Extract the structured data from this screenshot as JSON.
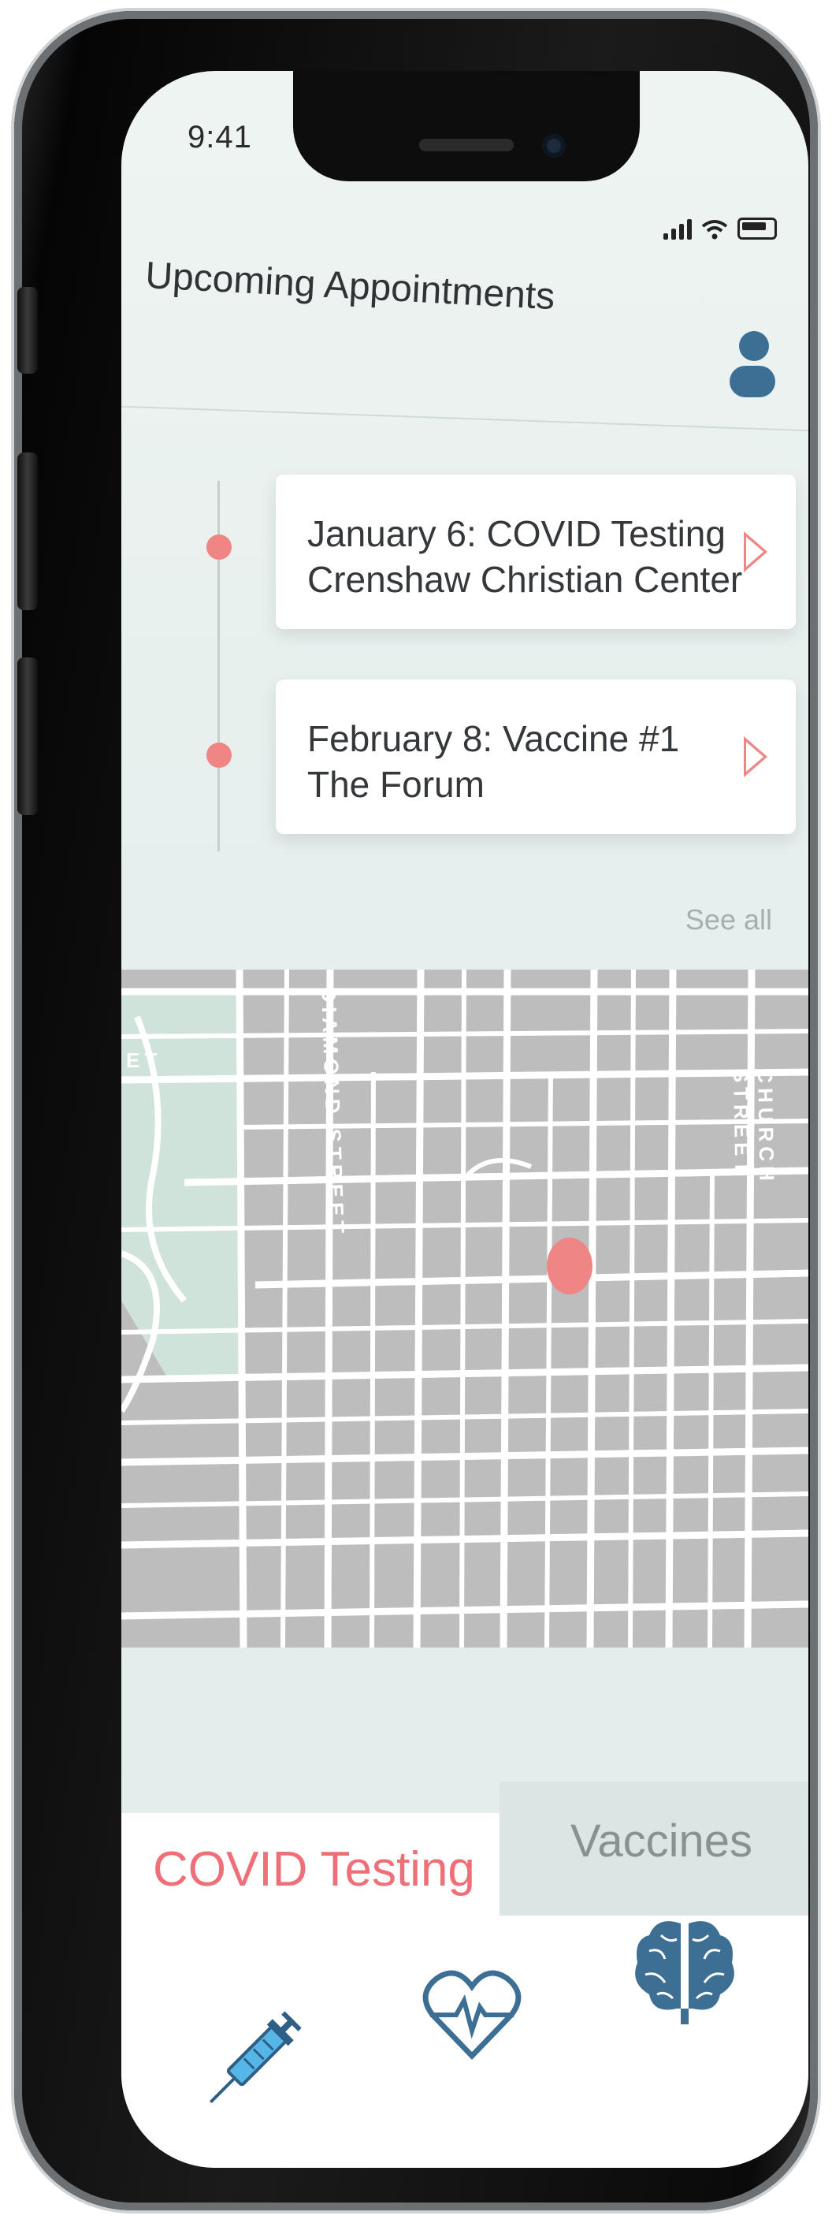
{
  "status_bar": {
    "time": "9:41",
    "icons": [
      "cellular-signal-icon",
      "wifi-icon",
      "battery-icon"
    ]
  },
  "header": {
    "title": "Upcoming Appointments",
    "profile_icon": "user-icon"
  },
  "appointments": [
    {
      "line1": "January 6: COVID Testing",
      "line2": "Crenshaw Christian Center"
    },
    {
      "line1": "February 8: Vaccine #1",
      "line2": "The Forum"
    }
  ],
  "see_all": "See all",
  "map": {
    "streets": [
      "DIAMOND STREET",
      "CHURCH STREET"
    ],
    "park_edge_label": "ET",
    "pin_icon": "location-pin-icon"
  },
  "tabs": [
    {
      "label": "COVID Testing",
      "active": true
    },
    {
      "label": "Vaccines",
      "active": false
    }
  ],
  "bottom_nav": {
    "icons": [
      "syringe-icon",
      "heart-pulse-icon",
      "brain-icon"
    ]
  },
  "colors": {
    "accent": "#ef8585",
    "tab_active_text": "#ef6f78",
    "icon_blue": "#3d6f95",
    "icon_light_blue": "#56b6e6",
    "map_road": "#ffffff",
    "map_block": "#bdbdbd",
    "map_park": "#cfe3da"
  }
}
